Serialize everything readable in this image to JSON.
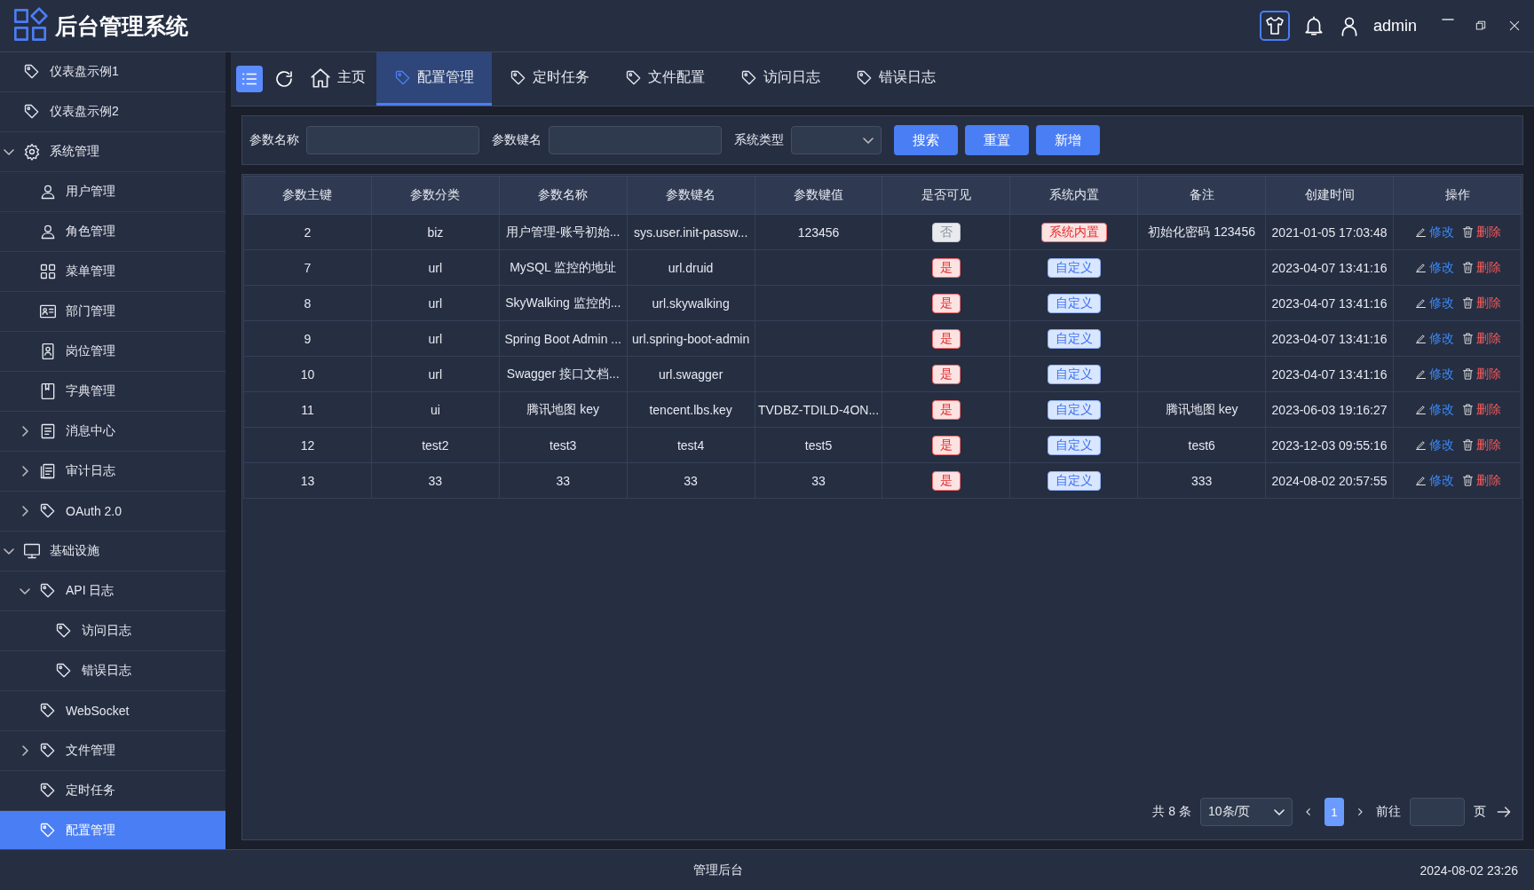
{
  "header": {
    "title": "后台管理系统",
    "user": "admin"
  },
  "sidebar": {
    "items": [
      {
        "label": "仪表盘示例1",
        "selected": false
      },
      {
        "label": "仪表盘示例2",
        "selected": false
      },
      {
        "label": "系统管理",
        "selected": false,
        "expanded": true,
        "children": [
          {
            "label": "用户管理",
            "selected": false
          },
          {
            "label": "角色管理",
            "selected": false
          },
          {
            "label": "菜单管理",
            "selected": false
          },
          {
            "label": "部门管理",
            "selected": false
          },
          {
            "label": "岗位管理",
            "selected": false
          },
          {
            "label": "字典管理",
            "selected": false
          },
          {
            "label": "消息中心",
            "selected": false,
            "expanded": false
          },
          {
            "label": "审计日志",
            "selected": false,
            "expanded": false
          },
          {
            "label": "OAuth 2.0",
            "selected": false,
            "expanded": false
          }
        ]
      },
      {
        "label": "基础设施",
        "selected": false,
        "expanded": true,
        "children": [
          {
            "label": "API 日志",
            "selected": false,
            "expanded": true,
            "children": [
              {
                "label": "访问日志",
                "selected": false
              },
              {
                "label": "错误日志",
                "selected": false
              }
            ]
          },
          {
            "label": "WebSocket",
            "selected": false
          },
          {
            "label": "文件管理",
            "selected": false,
            "expanded": false
          },
          {
            "label": "定时任务",
            "selected": false
          },
          {
            "label": "配置管理",
            "selected": true
          }
        ]
      }
    ]
  },
  "tabs": [
    {
      "label": "主页",
      "kind": "home",
      "selected": false
    },
    {
      "label": "配置管理",
      "kind": "page",
      "selected": true
    },
    {
      "label": "定时任务",
      "kind": "page",
      "selected": false
    },
    {
      "label": "文件配置",
      "kind": "page",
      "selected": false
    },
    {
      "label": "访问日志",
      "kind": "page",
      "selected": false
    },
    {
      "label": "错误日志",
      "kind": "page",
      "selected": false
    }
  ],
  "filters": [
    {
      "label": "参数名称",
      "kind": "input"
    },
    {
      "label": "参数键名",
      "kind": "input"
    },
    {
      "label": "系统类型",
      "kind": "select"
    }
  ],
  "filter_buttons": [
    "搜索",
    "重置",
    "新增"
  ],
  "table": {
    "columns": [
      "参数主键",
      "参数分类",
      "参数名称",
      "参数键名",
      "参数键值",
      "是否可见",
      "系统内置",
      "备注",
      "创建时间",
      "操作"
    ],
    "rows": [
      {
        "id": "2",
        "category": "biz",
        "name": "用户管理-账号初始...",
        "key": "sys.user.init-passw...",
        "value": "123456",
        "visible": {
          "text": "否",
          "kind": "info"
        },
        "builtin": {
          "text": "系统内置",
          "kind": "danger"
        },
        "remark": "初始化密码 123456",
        "created": "2021-01-05 17:03:48",
        "actions": [
          "修改",
          "删除"
        ]
      },
      {
        "id": "7",
        "category": "url",
        "name": "MySQL 监控的地址",
        "key": "url.druid",
        "value": "",
        "visible": {
          "text": "是",
          "kind": "danger"
        },
        "builtin": {
          "text": "自定义",
          "kind": "primary"
        },
        "remark": "",
        "created": "2023-04-07 13:41:16",
        "actions": [
          "修改",
          "删除"
        ]
      },
      {
        "id": "8",
        "category": "url",
        "name": "SkyWalking 监控的...",
        "key": "url.skywalking",
        "value": "",
        "visible": {
          "text": "是",
          "kind": "danger"
        },
        "builtin": {
          "text": "自定义",
          "kind": "primary"
        },
        "remark": "",
        "created": "2023-04-07 13:41:16",
        "actions": [
          "修改",
          "删除"
        ]
      },
      {
        "id": "9",
        "category": "url",
        "name": "Spring Boot Admin ...",
        "key": "url.spring-boot-admin",
        "value": "",
        "visible": {
          "text": "是",
          "kind": "danger"
        },
        "builtin": {
          "text": "自定义",
          "kind": "primary"
        },
        "remark": "",
        "created": "2023-04-07 13:41:16",
        "actions": [
          "修改",
          "删除"
        ]
      },
      {
        "id": "10",
        "category": "url",
        "name": "Swagger 接口文档...",
        "key": "url.swagger",
        "value": "",
        "visible": {
          "text": "是",
          "kind": "danger"
        },
        "builtin": {
          "text": "自定义",
          "kind": "primary"
        },
        "remark": "",
        "created": "2023-04-07 13:41:16",
        "actions": [
          "修改",
          "删除"
        ]
      },
      {
        "id": "11",
        "category": "ui",
        "name": "腾讯地图 key",
        "key": "tencent.lbs.key",
        "value": "TVDBZ-TDILD-4ON...",
        "visible": {
          "text": "是",
          "kind": "danger"
        },
        "builtin": {
          "text": "自定义",
          "kind": "primary"
        },
        "remark": "腾讯地图 key",
        "created": "2023-06-03 19:16:27",
        "actions": [
          "修改",
          "删除"
        ]
      },
      {
        "id": "12",
        "category": "test2",
        "name": "test3",
        "key": "test4",
        "value": "test5",
        "visible": {
          "text": "是",
          "kind": "danger"
        },
        "builtin": {
          "text": "自定义",
          "kind": "primary"
        },
        "remark": "test6",
        "created": "2023-12-03 09:55:16",
        "actions": [
          "修改",
          "删除"
        ]
      },
      {
        "id": "13",
        "category": "33",
        "name": "33",
        "key": "33",
        "value": "33",
        "visible": {
          "text": "是",
          "kind": "danger"
        },
        "builtin": {
          "text": "自定义",
          "kind": "primary"
        },
        "remark": "333",
        "created": "2024-08-02 20:57:55",
        "actions": [
          "修改",
          "删除"
        ]
      }
    ]
  },
  "pagination": {
    "total": "共 8 条",
    "page_size": "10条/页",
    "pages": [
      {
        "label": "1",
        "selected": true
      }
    ],
    "goto_label": "前往",
    "goto_suffix": "页"
  },
  "footer": {
    "center": "管理后台",
    "datetime": "2024-08-02 23:26"
  }
}
